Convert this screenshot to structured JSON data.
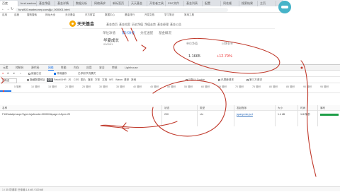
{
  "browser": {
    "tabs": [
      "百度",
      "fund.eastmoney.com",
      "基金净值",
      "基金详情",
      "数据分析",
      "网络请求",
      "新标签页",
      "天天基金",
      "开发者工具",
      "PDF文件",
      "基金列表",
      "配置",
      "同花顺",
      "搜索结果",
      "主页"
    ],
    "nav_back": "←",
    "nav_forward": "→",
    "nav_reload": "↻",
    "url": "fundf10.eastmoney.com/jjjz_000001.html",
    "bookmarks": [
      "应用",
      "百度",
      "搜狗搜索",
      "网址大全",
      "天天基金",
      "东方财富",
      "数据中心",
      "基金排行",
      "开发文档",
      "学习笔记",
      "常用工具"
    ]
  },
  "site": {
    "logo_text": "天天基金",
    "nav": [
      "基金首页",
      "基金档案",
      "历史净值",
      "净值走势",
      "基金经理",
      "基金公告"
    ],
    "section_nav": [
      "单位净值",
      "累计净值",
      "分红送配",
      "基金概况"
    ],
    "fund_name": "华夏成长",
    "fund_code": "000001",
    "nav_label": "单位净值",
    "day_change_label": "日增长率",
    "nav_value": "1.1665",
    "day_change": "+12.79%"
  },
  "devtools": {
    "tabs": [
      "元素",
      "控制台",
      "源代码",
      "网络",
      "性能",
      "内存",
      "应用",
      "安全",
      "审核",
      "Lighthouse"
    ],
    "active_tab": "网络",
    "toolbar": [
      "保留日志",
      "停用缓存",
      "已停用节流模式"
    ],
    "filter": [
      "筛选",
      "隐藏数据网址",
      "全部",
      "Fetch/XHR",
      "JS",
      "CSS",
      "图片",
      "媒体",
      "字体",
      "文档",
      "WS",
      "Wasm",
      "清单",
      "其他",
      "已阻止 Cookie",
      "已屏蔽请求",
      "第三方请求"
    ],
    "timeline_ticks": [
      "5 毫秒",
      "10 毫秒",
      "15 毫秒",
      "20 毫秒",
      "25 毫秒",
      "30 毫秒",
      "35 毫秒",
      "40 毫秒",
      "45 毫秒",
      "50 毫秒",
      "55 毫秒",
      "60 毫秒",
      "65 毫秒",
      "70 毫秒",
      "75 毫秒",
      "80 毫秒",
      "85 毫秒",
      "90 毫秒",
      "95 毫秒"
    ],
    "columns": [
      "名称",
      "状态",
      "类型",
      "发起程序",
      "大小",
      "时间",
      "瀑布"
    ],
    "rows": [
      {
        "name": "F10DataApi.aspx?type=lsjz&code=000001&page=1&per=20",
        "status": "200",
        "type": "xhr",
        "initiator": "jquery.min.js:4",
        "size": "1.4 kB",
        "time": "118 毫秒"
      }
    ],
    "status": "1 / 35 项请求  已传输 1.4 kB / 320 kB"
  },
  "colors": {
    "accent": "#1a73e8",
    "ink": "#c0392b",
    "waterfall": "#1e9e48",
    "up": "#e33333",
    "logo": "#f6a800"
  }
}
